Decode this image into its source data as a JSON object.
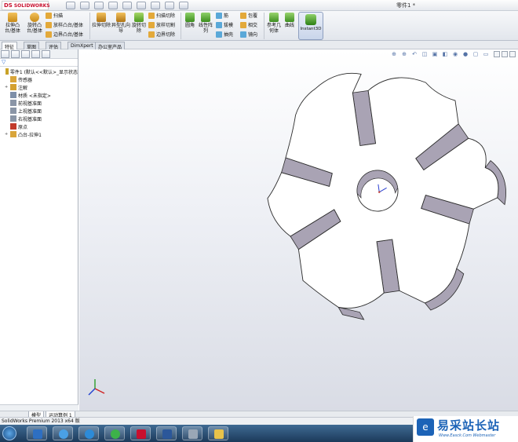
{
  "app": {
    "logo_brand": "DS",
    "logo_name": "SOLIDWORKS",
    "document_title": "零件1 *"
  },
  "ribbon": {
    "large_buttons": [
      {
        "label": "拉伸凸台/基体"
      },
      {
        "label": "旋转凸台/基体"
      },
      {
        "label": "拉伸切除"
      },
      {
        "label": "异型孔向导"
      },
      {
        "label": "旋转切除"
      },
      {
        "label": "圆角"
      },
      {
        "label": "线性阵列"
      },
      {
        "label": "参考几何体"
      },
      {
        "label": "曲线"
      }
    ],
    "small_buttons": [
      {
        "label": "扫描"
      },
      {
        "label": "放样凸台/基体"
      },
      {
        "label": "边界凸台/基体"
      },
      {
        "label": "扫描切除"
      },
      {
        "label": "放样切割"
      },
      {
        "label": "边界切除"
      },
      {
        "label": "筋"
      },
      {
        "label": "拔模"
      },
      {
        "label": "抽壳"
      },
      {
        "label": "包覆"
      },
      {
        "label": "相交"
      },
      {
        "label": "镜向"
      }
    ],
    "instant3d_label": "Instant3D"
  },
  "tabs": [
    {
      "label": "特征",
      "active": true
    },
    {
      "label": "草图",
      "active": false
    },
    {
      "label": "评估",
      "active": false
    },
    {
      "label": "DimXpert",
      "active": false
    },
    {
      "label": "办公室产品",
      "active": false
    }
  ],
  "feature_tree": {
    "items": [
      {
        "label": "零件1 (默认<<默认>_显示状态",
        "icon": "part-icon",
        "color": "#c9a227",
        "indent": 0,
        "expander": ""
      },
      {
        "label": "传感器",
        "icon": "sensor-icon",
        "color": "#d9a53a",
        "indent": 1,
        "expander": ""
      },
      {
        "label": "注解",
        "icon": "annotation-icon",
        "color": "#d4a02f",
        "indent": 1,
        "expander": "+"
      },
      {
        "label": "材质 <未指定>",
        "icon": "material-icon",
        "color": "#7e8fa8",
        "indent": 1,
        "expander": ""
      },
      {
        "label": "前视基准面",
        "icon": "plane-icon",
        "color": "#8a95a6",
        "indent": 1,
        "expander": ""
      },
      {
        "label": "上视基准面",
        "icon": "plane-icon",
        "color": "#8a95a6",
        "indent": 1,
        "expander": ""
      },
      {
        "label": "右视基准面",
        "icon": "plane-icon",
        "color": "#8a95a6",
        "indent": 1,
        "expander": ""
      },
      {
        "label": "原点",
        "icon": "origin-icon",
        "color": "#c23a2b",
        "indent": 1,
        "expander": ""
      },
      {
        "label": "凸台-拉伸1",
        "icon": "extrude-icon",
        "color": "#d9a53a",
        "indent": 1,
        "expander": "+"
      }
    ]
  },
  "bottom_tabs": [
    {
      "label": "模型"
    },
    {
      "label": "运动算例 1"
    }
  ],
  "status": {
    "text": "SolidWorks Premium 2013 x64 版"
  },
  "watermark": {
    "badge": "e",
    "chinese": "易采站长站",
    "english": "Www.Easck.Com Webmaster"
  },
  "colors": {
    "part_face": "#ffffff",
    "part_side": "#a7a1b2",
    "part_edge": "#2b2b2b",
    "accent": "#1c63b7"
  }
}
